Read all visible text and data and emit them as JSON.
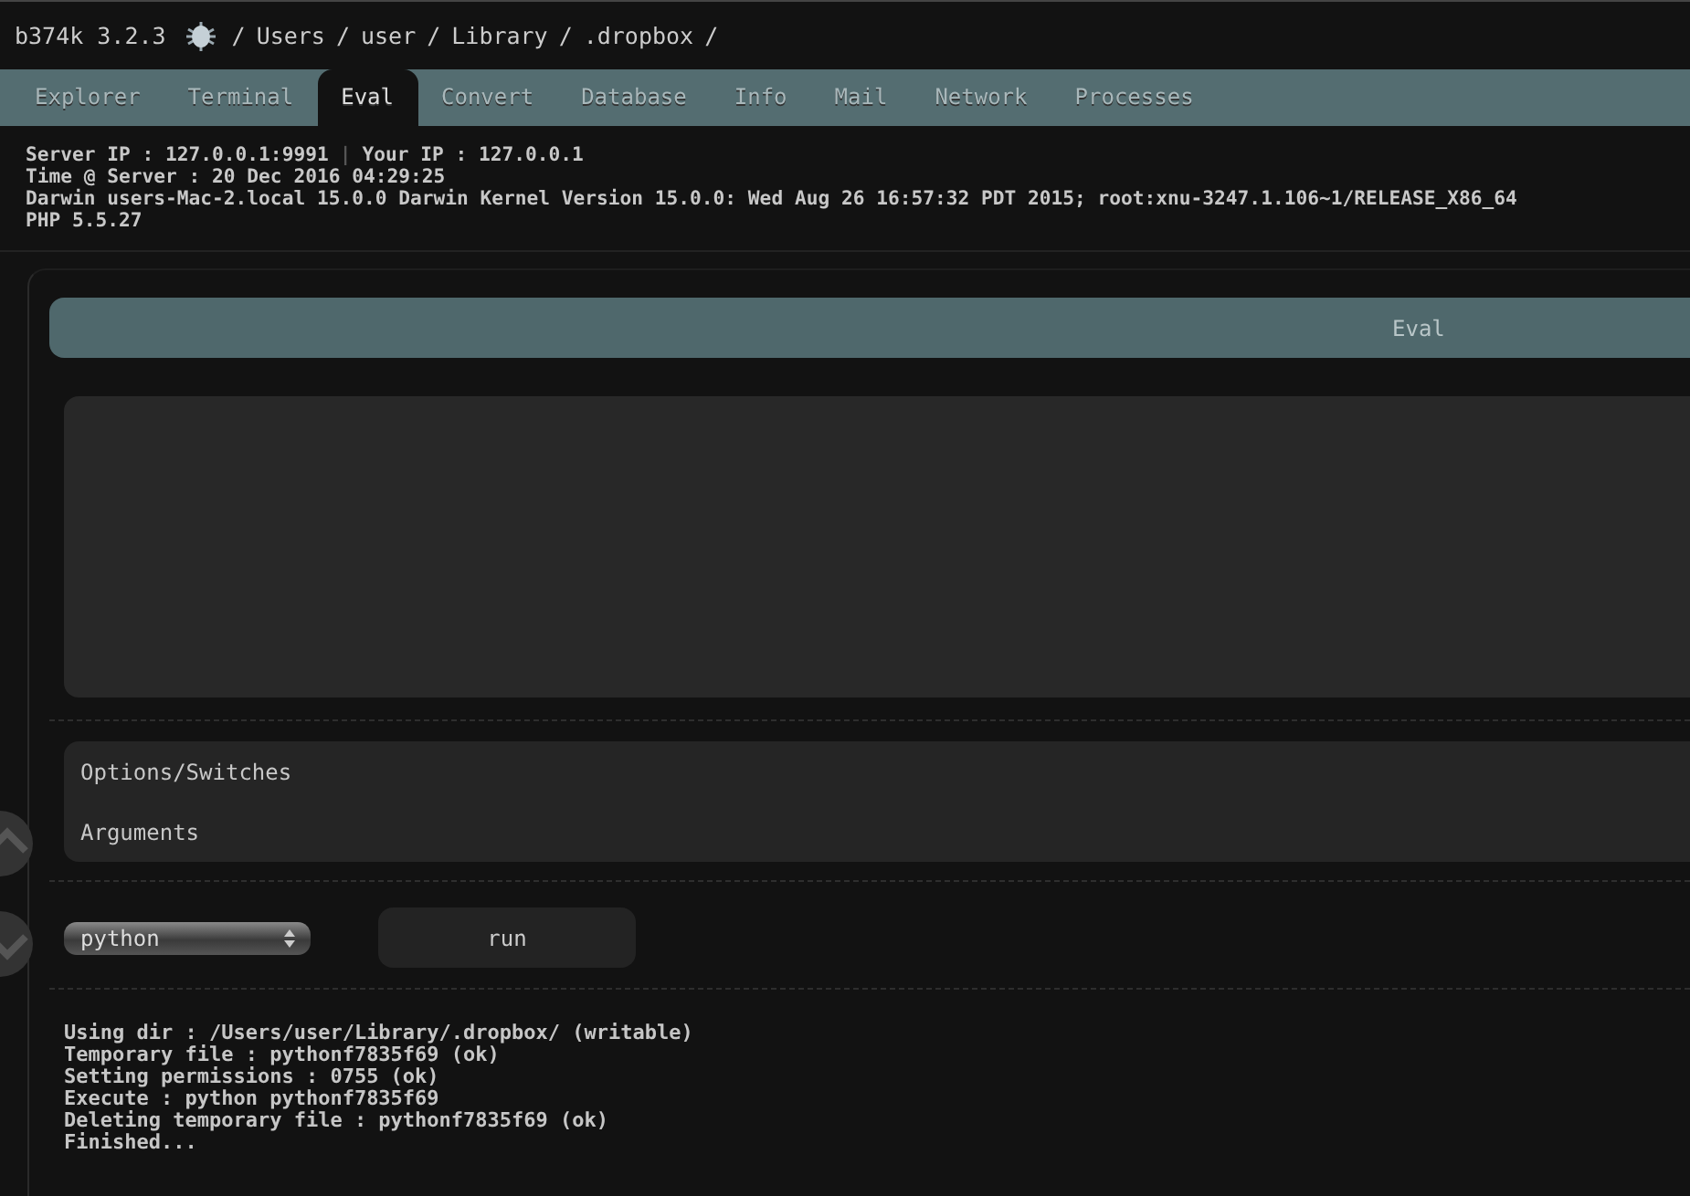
{
  "header": {
    "app": "b374k 3.2.3",
    "path": {
      "separator": "/",
      "segments": [
        "Users",
        "user",
        "Library",
        ".dropbox"
      ]
    }
  },
  "tabs": [
    {
      "label": "Explorer",
      "selected": false
    },
    {
      "label": "Terminal",
      "selected": false
    },
    {
      "label": "Eval",
      "selected": true
    },
    {
      "label": "Convert",
      "selected": false
    },
    {
      "label": "Database",
      "selected": false
    },
    {
      "label": "Info",
      "selected": false
    },
    {
      "label": "Mail",
      "selected": false
    },
    {
      "label": "Network",
      "selected": false
    },
    {
      "label": "Processes",
      "selected": false
    }
  ],
  "info": {
    "server_ip": "Server IP : 127.0.0.1:9991",
    "separator": "|",
    "your_ip": "Your IP : 127.0.0.1",
    "time": "Time @ Server : 20 Dec 2016 04:29:25",
    "system": "Darwin users-Mac-2.local 15.0.0 Darwin Kernel Version 15.0.0: Wed Aug 26 16:57:32 PDT 2015; root:xnu-3247.1.106~1/RELEASE_X86_64",
    "php": "PHP 5.5.27"
  },
  "eval": {
    "title": "Eval",
    "options_placeholder": "Options/Switches",
    "arguments_placeholder": "Arguments",
    "language": "python",
    "run_button": "run",
    "output": [
      "Using dir : /Users/user/Library/.dropbox/ (writable)",
      "Temporary file : pythonf7835f69 (ok)",
      "Setting permissions : 0755 (ok)",
      "Execute : python pythonf7835f69",
      "Deleting temporary file : pythonf7835f69 (ok)",
      "Finished..."
    ]
  }
}
